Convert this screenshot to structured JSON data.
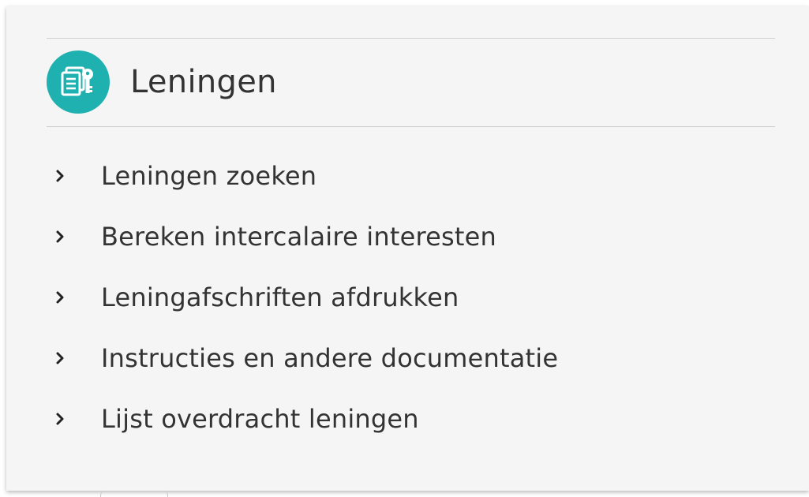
{
  "section": {
    "title": "Leningen",
    "icon": "loan-document-key-icon",
    "accent_color": "#1fb0b0"
  },
  "menu": {
    "items": [
      {
        "label": "Leningen zoeken"
      },
      {
        "label": "Bereken intercalaire interesten"
      },
      {
        "label": "Leningafschriften afdrukken"
      },
      {
        "label": "Instructies en andere documentatie"
      },
      {
        "label": "Lijst overdracht leningen"
      }
    ]
  }
}
